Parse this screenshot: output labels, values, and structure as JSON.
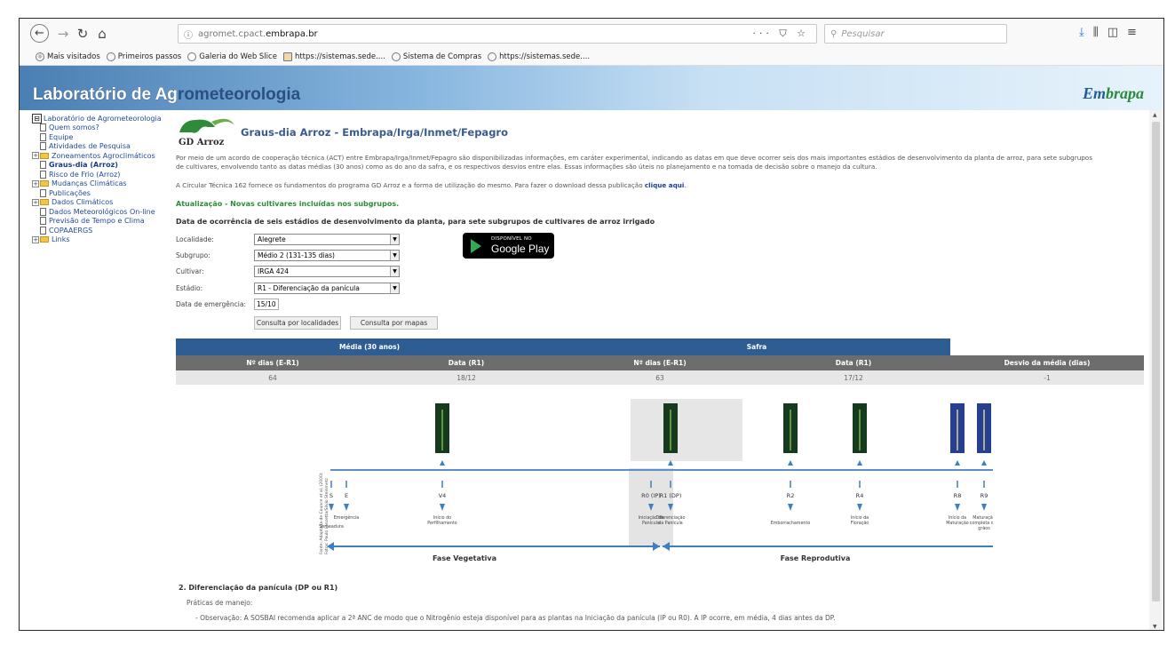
{
  "browser": {
    "url_host": "agromet.cpact.",
    "url_domain": "embrapa.br",
    "url_actions": "··· ⛉ ☆",
    "search_placeholder": "Pesquisar",
    "bookmarks": [
      "Mais visitados",
      "Primeiros passos",
      "Galeria do Web Slice",
      "https://sistemas.sede....",
      "Sistema de Compras",
      "https://sistemas.sede...."
    ]
  },
  "banner": {
    "title_light": "Laboratório de Ag",
    "title_dark": "rometeorologia",
    "logo_a": "Em",
    "logo_b": "brapa"
  },
  "sidebar": [
    {
      "label": "Laboratório de Agrometeorologia",
      "kind": "root"
    },
    {
      "label": "Quem somos?",
      "kind": "page"
    },
    {
      "label": "Equipe",
      "kind": "page"
    },
    {
      "label": "Atividades de Pesquisa",
      "kind": "page"
    },
    {
      "label": "Zoneamentos Agroclimáticos",
      "kind": "folder"
    },
    {
      "label": "Graus-dia (Arroz)",
      "kind": "page",
      "active": true
    },
    {
      "label": "Risco de Frio (Arroz)",
      "kind": "page"
    },
    {
      "label": "Mudanças Climáticas",
      "kind": "folder"
    },
    {
      "label": "Publicações",
      "kind": "page"
    },
    {
      "label": "Dados Climáticos",
      "kind": "folder"
    },
    {
      "label": "Dados Meteorológicos On-line",
      "kind": "page"
    },
    {
      "label": "Previsão de Tempo e Clima",
      "kind": "page"
    },
    {
      "label": "COPAAERGS",
      "kind": "page"
    },
    {
      "label": "Links",
      "kind": "folder"
    }
  ],
  "content": {
    "logo_text": "GD Arroz",
    "title": "Graus-dia Arroz - Embrapa/Irga/Inmet/Fepagro",
    "intro_1": "Por meio de um acordo de cooperação técnica (ACT) entre Embrapa/Irga/Inmet/Fepagro são disponibilizadas informações, em caráter experimental, indicando as datas em que deve ocorrer seis dos mais importantes estádios de desenvolvimento da planta de arroz, para sete subgrupos",
    "intro_2": "de cultivares, envolvendo tanto as datas médias (30 anos) como as do ano da safra, e os respectivos desvios entre elas. Essas informações são úteis no planejamento e na tomada de decisão sobre o manejo da cultura.",
    "circular": "A Circular Técnica 162 fornece os fundamentos do programa GD Arroz e a forma de utilização do mesmo. Para fazer o download dessa publicação ",
    "circular_link": "clique aqui",
    "update": "Atualização - Novas cultivares incluídas nos subgrupos.",
    "section": "Data de ocorrência de seis estádios de desenvolvimento da planta, para sete subgrupos de cultivares de arroz irrigado",
    "form": {
      "localidade_label": "Localidade:",
      "localidade": "Alegrete",
      "subgrupo_label": "Subgrupo:",
      "subgrupo": "Médio 2 (131-135 dias)",
      "cultivar_label": "Cultivar:",
      "cultivar": "IRGA 424",
      "estadio_label": "Estádio:",
      "estadio": "R1 - Diferenciação da panícula",
      "emergencia_label": "Data de emergência:",
      "emergencia": "15/10",
      "btn_local": "Consulta por localidades",
      "btn_mapas": "Consulta por mapas"
    },
    "gplay": {
      "small": "DISPONÍVEL NO",
      "big": "Google Play"
    },
    "table": {
      "media": "Média (30 anos)",
      "safra": "Safra",
      "h_dias1": "Nº dias (E-R1)",
      "h_data1": "Data (R1)",
      "h_dias2": "Nº dias (E-R1)",
      "h_data2": "Data (R1)",
      "h_desvio": "Desvio da média (dias)",
      "v_dias1": "64",
      "v_data1": "18/12",
      "v_dias2": "63",
      "v_data2": "17/12",
      "v_desvio": "-1"
    },
    "diagram": {
      "stages": [
        "S",
        "E",
        "V4",
        "R0 (IP)",
        "R1 (DP)",
        "R2",
        "R4",
        "R8",
        "R9"
      ],
      "desc": [
        "Semeadura",
        "Emergência",
        "Início do Perfilhamento",
        "Iniciação da Panícula",
        "Diferenciação da Panícula",
        "Emborrachamento",
        "Início da Floração",
        "Início da Maturação",
        "Maturação completa dos grãos"
      ],
      "fase_veg": "Fase Vegetativa",
      "fase_rep": "Fase Reprodutiva",
      "source": "Fonte: Adaptada de Counce et al. (2000)",
      "photo": "Fotos: Paulo Lanzetta/Silvio Steinmetz"
    },
    "item2": "2. Diferenciação da panícula (DP ou R1)",
    "praticas": "Práticas de manejo:",
    "obs": "- Observação: A SOSBAI recomenda aplicar a 2ª ANC de modo que o Nitrogênio esteja disponível para as plantas na Iniciação da panícula (IP ou R0). A IP ocorre, em média, 4 dias antes da DP."
  }
}
